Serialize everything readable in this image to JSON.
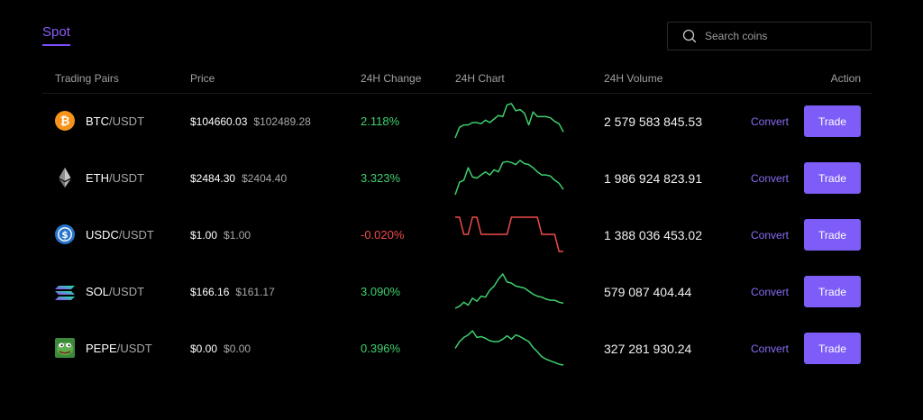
{
  "tabs": {
    "spot_label": "Spot"
  },
  "search": {
    "placeholder": "Search coins"
  },
  "table": {
    "headers": {
      "pair": "Trading Pairs",
      "price": "Price",
      "change": "24H Change",
      "chart": "24H Chart",
      "volume": "24H Volume",
      "action": "Action"
    },
    "rows": [
      {
        "base": "BTC",
        "sep": "/",
        "quote": "USDT",
        "icon": "bitcoin-icon",
        "price": "$104660.03",
        "prev_price": "$102489.28",
        "change": "2.118%",
        "trend": "up",
        "volume": "2 579 583 845.53",
        "convert": "Convert",
        "trade": "Trade",
        "spark": [
          2,
          11,
          13,
          13,
          15,
          15,
          14,
          17,
          15,
          18,
          21,
          20,
          30,
          31,
          25,
          26,
          23,
          13,
          24,
          20,
          20,
          20,
          19,
          16,
          14,
          7
        ]
      },
      {
        "base": "ETH",
        "sep": "/",
        "quote": "USDT",
        "icon": "ethereum-icon",
        "price": "$2484.30",
        "prev_price": "$2404.40",
        "change": "3.323%",
        "trend": "up",
        "volume": "1 986 924 823.91",
        "convert": "Convert",
        "trade": "Trade",
        "spark": [
          2,
          14,
          16,
          28,
          19,
          18,
          21,
          24,
          21,
          26,
          24,
          33,
          34,
          33,
          31,
          35,
          32,
          31,
          28,
          24,
          21,
          21,
          20,
          16,
          13,
          7
        ]
      },
      {
        "base": "USDC",
        "sep": "/",
        "quote": "USDT",
        "icon": "usdc-icon",
        "price": "$1.00",
        "prev_price": "$1.00",
        "change": "-0.020%",
        "trend": "down",
        "volume": "1 388 036 453.02",
        "convert": "Convert",
        "trade": "Trade",
        "spark": [
          1.0001,
          1.0001,
          1.0,
          1.0,
          1.0001,
          1.0001,
          1.0,
          1.0,
          1.0,
          1.0,
          1.0,
          1.0,
          1.0,
          1.0001,
          1.0001,
          1.0001,
          1.0001,
          1.0001,
          1.0001,
          1.0001,
          1.0,
          1.0,
          1.0,
          1.0,
          0.9999,
          0.9999
        ]
      },
      {
        "base": "SOL",
        "sep": "/",
        "quote": "USDT",
        "icon": "solana-icon",
        "price": "$166.16",
        "prev_price": "$161.17",
        "change": "3.090%",
        "trend": "up",
        "volume": "579 087 404.44",
        "convert": "Convert",
        "trade": "Trade",
        "spark": [
          2,
          4,
          8,
          5,
          12,
          9,
          14,
          13,
          20,
          24,
          31,
          36,
          28,
          27,
          24,
          23,
          22,
          19,
          16,
          14,
          13,
          11,
          10,
          10,
          8,
          7
        ]
      },
      {
        "base": "PEPE",
        "sep": "/",
        "quote": "USDT",
        "icon": "pepe-frog-icon",
        "price": "$0.00",
        "prev_price": "$0.00",
        "change": "0.396%",
        "trend": "up",
        "volume": "327 281 930.24",
        "convert": "Convert",
        "trade": "Trade",
        "spark": [
          22,
          30,
          35,
          38,
          43,
          35,
          36,
          34,
          31,
          30,
          30,
          33,
          37,
          33,
          38,
          36,
          33,
          30,
          23,
          18,
          12,
          9,
          7,
          5,
          3,
          2
        ]
      }
    ]
  },
  "colors": {
    "accent": "#7d5cf7",
    "up": "#3ecf6e",
    "down": "#ef4b4b"
  }
}
